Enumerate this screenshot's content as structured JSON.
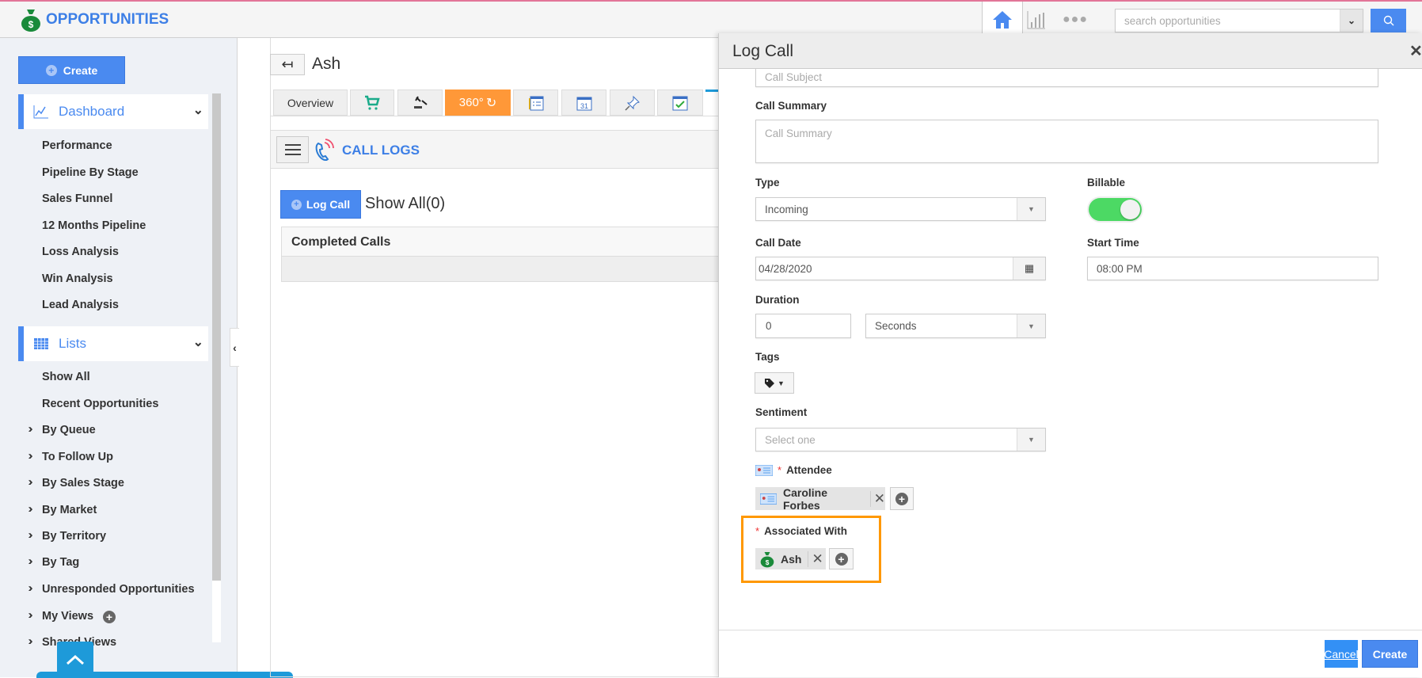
{
  "app": {
    "title": "OPPORTUNITIES",
    "accent": "#4a8af0",
    "highlight": "#ff9800"
  },
  "header": {
    "search_placeholder": "search opportunities",
    "icons": [
      "home-icon",
      "chart-icon",
      "more-icon",
      "chevron-down-icon",
      "search-icon"
    ]
  },
  "sidebar": {
    "create_label": "Create",
    "dashboard": {
      "label": "Dashboard",
      "items": [
        "Performance",
        "Pipeline By Stage",
        "Sales Funnel",
        "12 Months Pipeline",
        "Loss Analysis",
        "Win Analysis",
        "Lead Analysis"
      ]
    },
    "lists": {
      "label": "Lists",
      "items": [
        "Show All",
        "Recent Opportunities"
      ],
      "groups": [
        "By Queue",
        "To Follow Up",
        "By Sales Stage",
        "By Market",
        "By Territory",
        "By Tag",
        "Unresponded Opportunities",
        "My Views",
        "Shared Views"
      ]
    }
  },
  "record": {
    "title": "Ash",
    "tabs": {
      "overview": "Overview",
      "360": "360°"
    }
  },
  "call_logs": {
    "title": "CALL LOGS",
    "log_call_label": "Log Call",
    "show_all": "Show All(0)",
    "completed_header": "Completed Calls"
  },
  "modal": {
    "title": "Log Call",
    "call_subject_placeholder": "Call Subject",
    "call_summary_label": "Call Summary",
    "call_summary_placeholder": "Call Summary",
    "type_label": "Type",
    "type_value": "Incoming",
    "billable_label": "Billable",
    "billable_on": true,
    "call_date_label": "Call Date",
    "call_date_value": "04/28/2020",
    "start_time_label": "Start Time",
    "start_time_value": "08:00 PM",
    "duration_label": "Duration",
    "duration_value": "0",
    "duration_unit": "Seconds",
    "tags_label": "Tags",
    "sentiment_label": "Sentiment",
    "sentiment_placeholder": "Select one",
    "attendee_label": "Attendee",
    "attendee_value": "Caroline Forbes",
    "associated_label": "Associated With",
    "associated_value": "Ash",
    "required_mark": "*",
    "cancel_label": "Cancel",
    "create_label": "Create"
  }
}
